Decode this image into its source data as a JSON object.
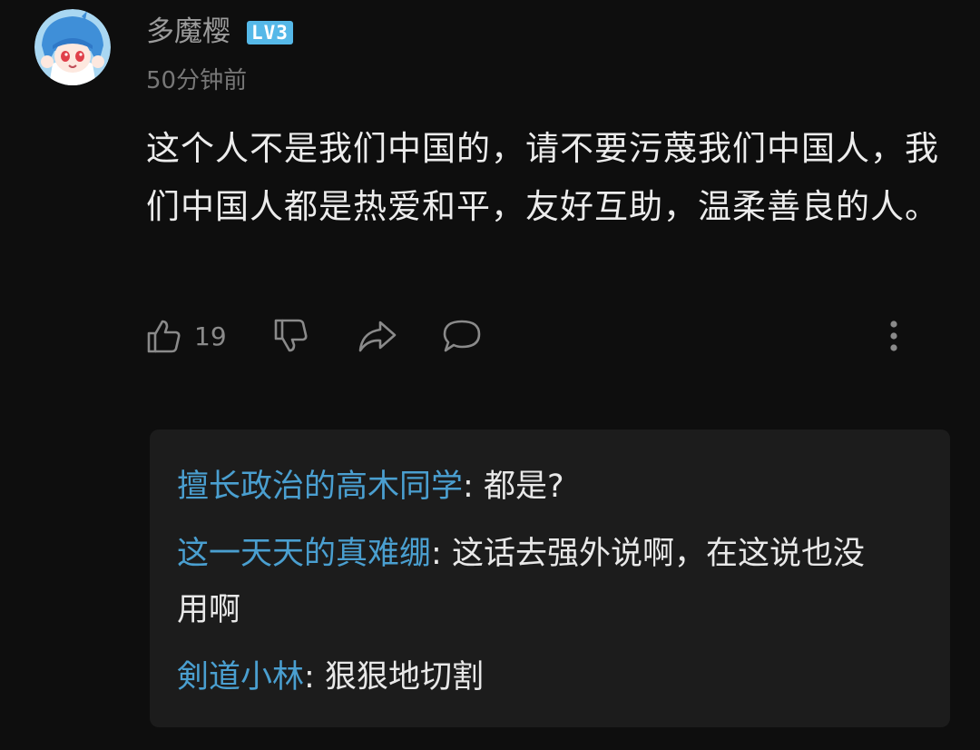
{
  "comment": {
    "username": "多魔樱",
    "level": "LV3",
    "timestamp": "50分钟前",
    "body": "这个人不是我们中国的，请不要污蔑我们中国人，我们中国人都是热爱和平，友好互助，温柔善良的人。",
    "like_count": "19"
  },
  "icons": {
    "like": "thumbs-up-icon",
    "dislike": "thumbs-down-icon",
    "share": "share-icon",
    "reply": "comment-icon",
    "more": "more-vertical-icon"
  },
  "replies": [
    {
      "author": "擅长政治的高木同学",
      "separator": ": ",
      "text": "都是?"
    },
    {
      "author": "这一天天的真难绷",
      "separator": ": ",
      "text": "这话去强外说啊，在这说也没用啊"
    },
    {
      "author": "剣道小林",
      "separator": ": ",
      "text": "狠狠地切割"
    }
  ],
  "colors": {
    "background": "#0e0e0e",
    "reply_box": "#1c1c1c",
    "author_link": "#4a9fd0",
    "level_badge": "#55b8e8"
  }
}
